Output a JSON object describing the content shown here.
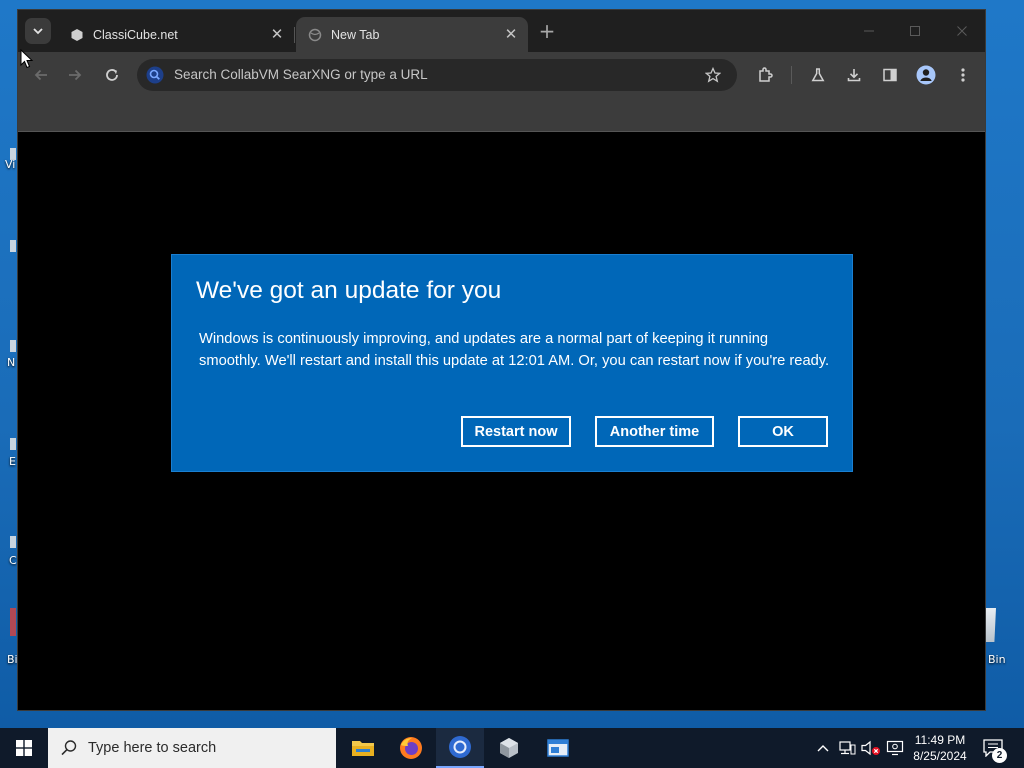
{
  "desktop": {
    "partial_labels": [
      "Vi",
      "N",
      "E",
      "C",
      "Bi"
    ],
    "recycle_label": "Bin"
  },
  "browser": {
    "tabs": [
      {
        "title": "ClassiCube.net",
        "active": false
      },
      {
        "title": "New Tab",
        "active": true
      }
    ],
    "omnibox": {
      "placeholder": "Search CollabVM SearXNG or type a URL"
    },
    "colors": {
      "frame": "#1f1f1f",
      "toolbar": "#3c3c3c",
      "omnibox": "#282828",
      "search_icon": "#7aa7ff"
    }
  },
  "dialog": {
    "title": "We've got an update for you",
    "body": "Windows is continuously improving, and updates are a normal part of keeping it running smoothly. We'll restart and install this update at 12:01 AM. Or, you can restart now if you're ready.",
    "buttons": {
      "restart": "Restart now",
      "another": "Another time",
      "ok": "OK"
    },
    "colors": {
      "background": "#0067b8",
      "text": "#ffffff"
    }
  },
  "taskbar": {
    "search_placeholder": "Type here to search",
    "apps": [
      "file-explorer-icon",
      "firefox-icon",
      "chromium-icon",
      "package-icon",
      "window-app-icon"
    ],
    "tray": [
      "chevron-up-icon",
      "network-icon",
      "volume-muted-icon",
      "display-icon"
    ],
    "clock": {
      "time": "11:49 PM",
      "date": "8/25/2024"
    },
    "notifications": {
      "count": "2"
    }
  }
}
